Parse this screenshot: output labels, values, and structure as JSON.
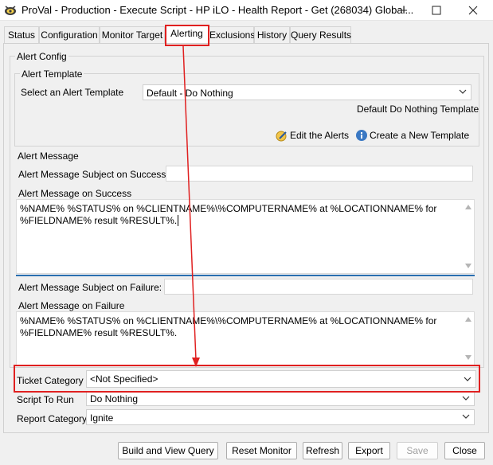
{
  "window": {
    "title": "ProVal - Production - Execute Script - HP iLO - Health Report - Get (268034) Global...",
    "controls": [
      "minimize",
      "maximize",
      "close"
    ]
  },
  "tabs": [
    {
      "label": "Status",
      "active": false
    },
    {
      "label": "Configuration",
      "active": false
    },
    {
      "label": "Monitor Target",
      "active": false
    },
    {
      "label": "Alerting",
      "active": true
    },
    {
      "label": "Exclusions",
      "active": false
    },
    {
      "label": "History",
      "active": false
    },
    {
      "label": "Query Results",
      "active": false
    }
  ],
  "alert_config": {
    "group_label": "Alert Config",
    "template": {
      "group_label": "Alert Template",
      "select_label": "Select an Alert Template",
      "selected": "Default - Do Nothing",
      "description": "Default Do Nothing Template",
      "edit_alerts": "Edit the Alerts",
      "create_template": "Create a New Template"
    },
    "message": {
      "group_label": "Alert Message",
      "subject_success_label": "Alert Message Subject on Success:",
      "subject_success_value": "",
      "success_label": "Alert Message on Success",
      "success_body": "%NAME% %STATUS% on %CLIENTNAME%\\%COMPUTERNAME% at %LOCATIONNAME% for %FIELDNAME% result %RESULT%.",
      "subject_failure_label": "Alert Message Subject on Failure:",
      "subject_failure_value": "",
      "failure_label": "Alert Message on Failure",
      "failure_body": "%NAME% %STATUS% on %CLIENTNAME%\\%COMPUTERNAME% at %LOCATIONNAME% for %FIELDNAME% result %RESULT%."
    }
  },
  "ticket_category": {
    "label": "Ticket Category",
    "selected": "<Not Specified>"
  },
  "script_to_run": {
    "label": "Script To Run",
    "selected": "Do Nothing"
  },
  "report_category": {
    "label": "Report Category",
    "selected": "Ignite"
  },
  "buttons": {
    "build_view_query": "Build and View Query",
    "reset_monitor": "Reset Monitor",
    "refresh": "Refresh",
    "export": "Export",
    "save": "Save",
    "close": "Close"
  },
  "colors": {
    "annotation_red": "#e02020",
    "separator_blue": "#2a6fb0",
    "info_icon_blue": "#3a78c3"
  }
}
